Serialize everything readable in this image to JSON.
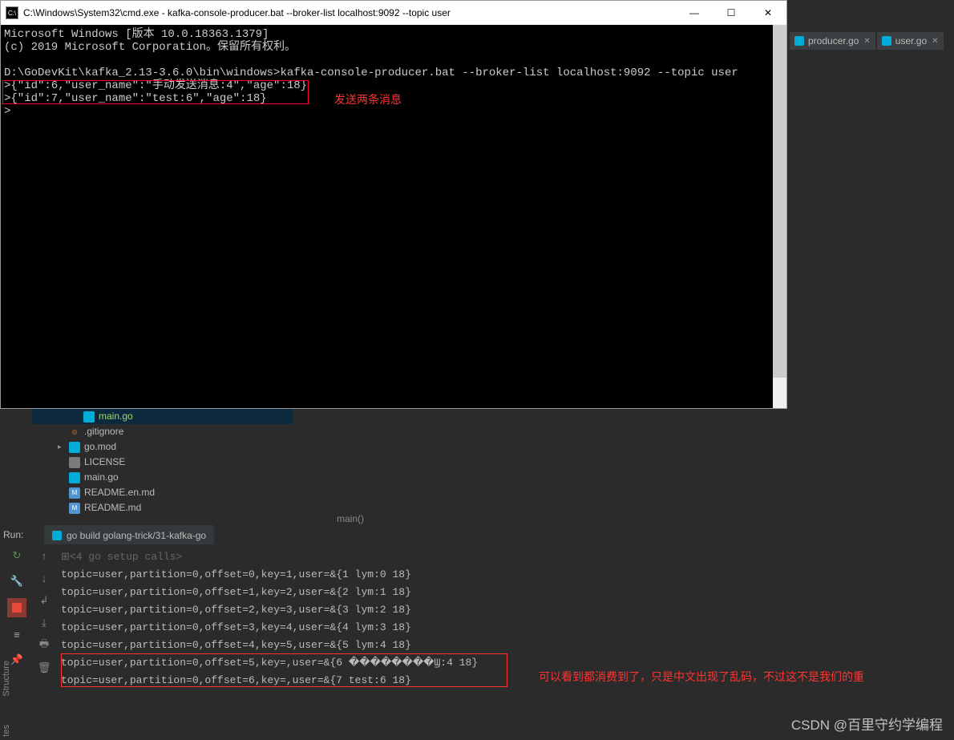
{
  "cmd": {
    "title": "C:\\Windows\\System32\\cmd.exe - kafka-console-producer.bat  --broker-list localhost:9092 --topic user",
    "lines": {
      "l1": "Microsoft Windows [版本 10.0.18363.1379]",
      "l2": "(c) 2019 Microsoft Corporation。保留所有权利。",
      "l3": "",
      "l4": "D:\\GoDevKit\\kafka_2.13-3.6.0\\bin\\windows>kafka-console-producer.bat --broker-list localhost:9092 --topic user",
      "l5": ">{\"id\":6,\"user_name\":\"手动发送消息:4\",\"age\":18}",
      "l6": ">{\"id\":7,\"user_name\":\"test:6\",\"age\":18}",
      "l7": ">"
    },
    "annotation1": "发送两条消息"
  },
  "ide_tabs": {
    "t1": "producer.go",
    "t2": "user.go"
  },
  "tree": {
    "main_go_sel": "main.go",
    "gitignore": ".gitignore",
    "gomod": "go.mod",
    "license": "LICENSE",
    "maingo": "main.go",
    "readme_en": "README.en.md",
    "readme": "README.md"
  },
  "breadcrumb": "main()",
  "run": {
    "label": "Run:",
    "tab": "go build golang-trick/31-kafka-go",
    "fold": "<4 go setup calls>",
    "r1": "topic=user,partition=0,offset=0,key=1,user=&{1 lym:0 18}",
    "r2": "topic=user,partition=0,offset=1,key=2,user=&{2 lym:1 18}",
    "r3": "topic=user,partition=0,offset=2,key=3,user=&{3 lym:2 18}",
    "r4": "topic=user,partition=0,offset=3,key=4,user=&{4 lym:3 18}",
    "r5": "topic=user,partition=0,offset=4,key=5,user=&{5 lym:4 18}",
    "r6": "topic=user,partition=0,offset=5,key=,user=&{6 ��������Ϣ:4 18}",
    "r7": "topic=user,partition=0,offset=6,key=,user=&{7 test:6 18}"
  },
  "annotation2": "可以看到都消费到了，只是中文出现了乱码，不过这不是我们的重",
  "sidebar": {
    "structure": "Structure",
    "favorites": "tes"
  },
  "watermark": "CSDN @百里守约学编程"
}
